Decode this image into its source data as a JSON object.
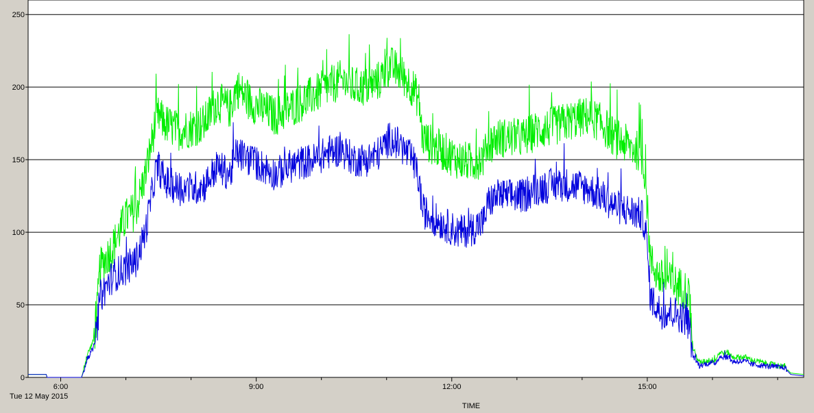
{
  "chart_data": {
    "type": "line",
    "xlabel": "TIME",
    "date_label": "Tue 12 May 2015",
    "x_unit": "hours",
    "xlim": [
      5.5,
      17.4
    ],
    "ylim": [
      0,
      260
    ],
    "y_ticks": [
      0,
      50,
      100,
      150,
      200,
      250
    ],
    "x_ticks": [
      {
        "value": 6,
        "label": "6:00"
      },
      {
        "value": 9,
        "label": "9:00"
      },
      {
        "value": 12,
        "label": "12:00"
      },
      {
        "value": 15,
        "label": "15:00"
      }
    ],
    "x_minor_ticks": [
      7,
      8,
      10,
      11,
      13,
      14,
      16,
      17
    ],
    "grid": true,
    "series": [
      {
        "color": "#00ee00",
        "noise": 14,
        "x": [
          5.5,
          5.78,
          5.79,
          6.32,
          6.35,
          6.4,
          6.5,
          6.55,
          6.6,
          6.8,
          7.0,
          7.15,
          7.3,
          7.45,
          7.5,
          7.6,
          7.8,
          8.0,
          8.2,
          8.4,
          8.6,
          8.7,
          8.9,
          9.1,
          9.3,
          9.5,
          9.7,
          9.9,
          10.1,
          10.3,
          10.5,
          10.7,
          10.9,
          11.05,
          11.2,
          11.4,
          11.5,
          11.55,
          11.7,
          11.9,
          12.1,
          12.3,
          12.5,
          12.55,
          12.7,
          12.9,
          13.1,
          13.3,
          13.5,
          13.7,
          13.9,
          14.1,
          14.3,
          14.5,
          14.7,
          14.9,
          14.97,
          15.05,
          15.2,
          15.4,
          15.6,
          15.65,
          15.7,
          15.8,
          15.95,
          16.05,
          16.1,
          16.25,
          16.3,
          16.5,
          16.6,
          16.8,
          17.0,
          17.1,
          17.2,
          17.4
        ],
        "y": [
          2,
          2,
          0,
          0,
          5,
          15,
          25,
          40,
          75,
          90,
          110,
          115,
          140,
          175,
          180,
          175,
          170,
          172,
          175,
          190,
          185,
          200,
          190,
          185,
          180,
          185,
          190,
          195,
          200,
          205,
          200,
          200,
          205,
          215,
          210,
          200,
          190,
          165,
          160,
          155,
          150,
          148,
          152,
          160,
          165,
          165,
          165,
          170,
          172,
          175,
          178,
          180,
          175,
          165,
          160,
          155,
          140,
          80,
          68,
          65,
          60,
          55,
          20,
          10,
          12,
          12,
          17,
          17,
          14,
          14,
          12,
          10,
          8,
          8,
          3,
          2
        ]
      },
      {
        "color": "#0000dd",
        "noise": 12,
        "x": [
          5.5,
          5.78,
          5.79,
          6.32,
          6.35,
          6.4,
          6.5,
          6.55,
          6.6,
          6.8,
          7.0,
          7.15,
          7.3,
          7.45,
          7.5,
          7.6,
          7.8,
          8.0,
          8.2,
          8.4,
          8.6,
          8.7,
          8.9,
          9.1,
          9.3,
          9.5,
          9.7,
          9.9,
          10.1,
          10.3,
          10.5,
          10.7,
          10.9,
          11.05,
          11.2,
          11.4,
          11.5,
          11.55,
          11.7,
          11.9,
          12.1,
          12.3,
          12.5,
          12.55,
          12.7,
          12.9,
          13.1,
          13.3,
          13.5,
          13.7,
          13.9,
          14.1,
          14.3,
          14.5,
          14.7,
          14.9,
          14.97,
          15.05,
          15.2,
          15.4,
          15.6,
          15.65,
          15.7,
          15.8,
          15.95,
          16.05,
          16.1,
          16.25,
          16.3,
          16.5,
          16.6,
          16.8,
          17.0,
          17.1,
          17.2,
          17.4
        ],
        "y": [
          2,
          2,
          0,
          0,
          4,
          12,
          20,
          30,
          55,
          70,
          75,
          80,
          100,
          140,
          145,
          135,
          130,
          130,
          132,
          145,
          140,
          155,
          150,
          145,
          140,
          145,
          148,
          150,
          155,
          157,
          150,
          150,
          155,
          165,
          160,
          150,
          135,
          115,
          110,
          105,
          100,
          102,
          108,
          120,
          125,
          125,
          125,
          130,
          132,
          133,
          132,
          130,
          125,
          118,
          115,
          112,
          105,
          55,
          45,
          45,
          40,
          35,
          15,
          8,
          10,
          10,
          14,
          14,
          11,
          11,
          9,
          8,
          7,
          7,
          2,
          1
        ]
      }
    ]
  }
}
